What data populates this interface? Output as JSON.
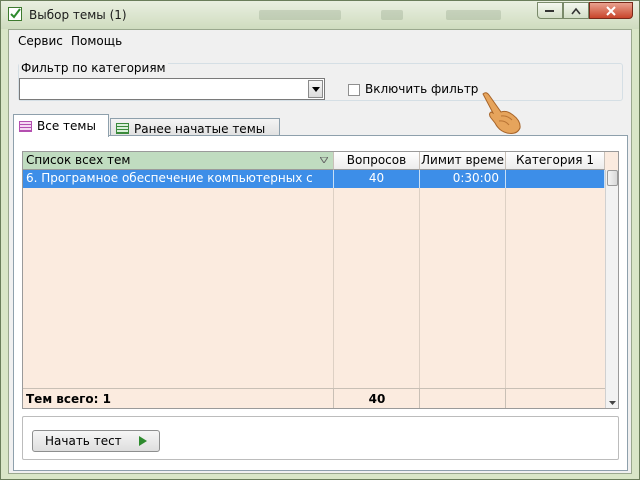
{
  "window": {
    "title": "Выбор темы (1)"
  },
  "menu": {
    "items": [
      "Сервис",
      "Помощь"
    ]
  },
  "filter": {
    "group_label": "Фильтр по категориям",
    "combo_value": "",
    "enable_label": "Включить фильтр",
    "enabled": false
  },
  "tabs": [
    {
      "label": "Все темы",
      "active": true,
      "icon": "table-icon"
    },
    {
      "label": "Ранее начатые темы",
      "active": false,
      "icon": "table-icon"
    }
  ],
  "grid": {
    "columns": [
      "Список всех тем",
      "Вопросов",
      "Лимит време",
      "Категория 1"
    ],
    "sorted_column": "Список всех тем",
    "rows": [
      [
        "6. Програмное обеспечение компьютерных с",
        "40",
        "0:30:00",
        ""
      ]
    ],
    "footer": {
      "label": "Тем всего: 1",
      "questions_total": "40"
    }
  },
  "actions": {
    "start_label": "Начать тест"
  },
  "colors": {
    "selection": "#3d8ee8",
    "grid_bg": "#fbebdf",
    "sorted_header": "#c0dcc0",
    "window_frame": "#d9e6c7",
    "play_arrow": "#2e8b2e"
  }
}
